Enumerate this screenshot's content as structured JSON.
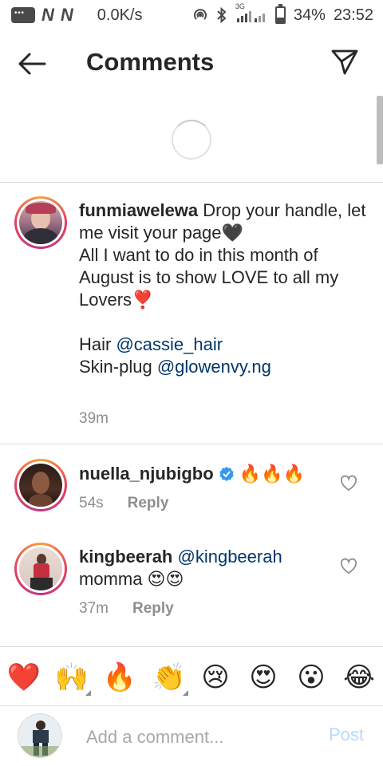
{
  "status_bar": {
    "n1": "N",
    "n2": "N",
    "speed": "0.0K/s",
    "network": "3G",
    "battery": "34%",
    "time": "23:52"
  },
  "header": {
    "title": "Comments",
    "back_icon": "arrow-left-icon",
    "send_icon": "paper-plane-icon"
  },
  "caption": {
    "username": "funmiawelewa",
    "text_line1": " Drop your handle, let me visit your page",
    "emoji_heart": "🖤",
    "text_line2": "All I want to do in this month of August is to show LOVE to all my Lovers",
    "emoji_heart2": "❣️",
    "hair_label": "Hair ",
    "hair_mention": "@cassie_hair",
    "skin_label": "Skin-plug ",
    "skin_mention": "@glowenvy.ng",
    "time": "39m"
  },
  "comments": [
    {
      "username": "nuella_njubigbo",
      "text": " 🔥🔥🔥",
      "time": "54s",
      "reply_label": "Reply"
    },
    {
      "username": "kingbeerah",
      "mention": "@kingbeerah",
      "text": "momma 😍😍",
      "time": "37m",
      "reply_label": "Reply"
    }
  ],
  "emoji_bar": [
    "❤️",
    "🙌",
    "🔥",
    "👏",
    "😢",
    "😍",
    "😮",
    "😂"
  ],
  "composer": {
    "placeholder": "Add a comment...",
    "post_label": "Post"
  },
  "colors": {
    "mention": "#00376b",
    "post_disabled": "#b3dbff",
    "meta_gray": "#8e8e8e"
  }
}
